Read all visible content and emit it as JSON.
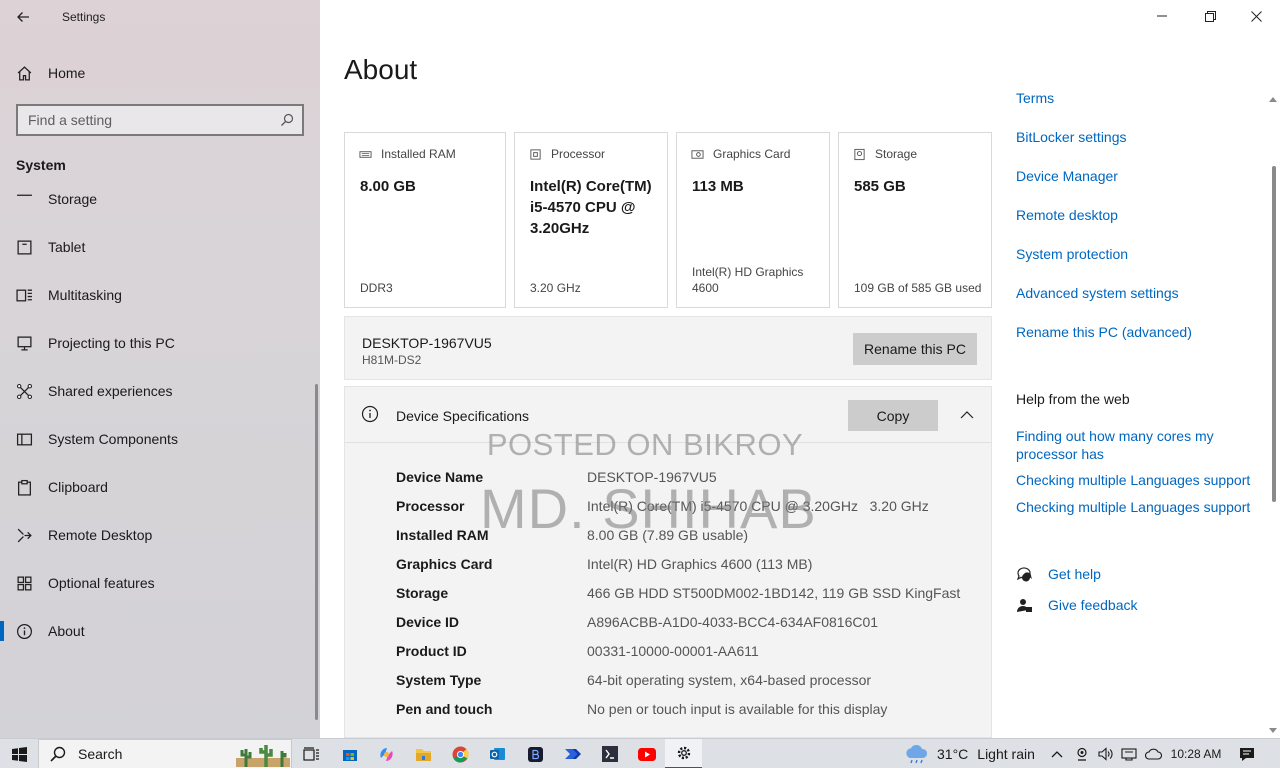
{
  "window": {
    "app_title": "Settings"
  },
  "sidebar": {
    "home_label": "Home",
    "search_placeholder": "Find a setting",
    "section_title": "System",
    "items": [
      {
        "label": "Storage",
        "icon": "storage-icon"
      },
      {
        "label": "Tablet",
        "icon": "tablet-icon"
      },
      {
        "label": "Multitasking",
        "icon": "multitasking-icon"
      },
      {
        "label": "Projecting to this PC",
        "icon": "projecting-icon"
      },
      {
        "label": "Shared experiences",
        "icon": "shared-experiences-icon"
      },
      {
        "label": "System Components",
        "icon": "system-components-icon"
      },
      {
        "label": "Clipboard",
        "icon": "clipboard-icon"
      },
      {
        "label": "Remote Desktop",
        "icon": "remote-desktop-icon"
      },
      {
        "label": "Optional features",
        "icon": "optional-features-icon"
      },
      {
        "label": "About",
        "icon": "about-icon",
        "active": true
      }
    ]
  },
  "main": {
    "page_title": "About",
    "cards": [
      {
        "title": "Installed RAM",
        "value": "8.00 GB",
        "foot": "DDR3",
        "icon": "ram-icon"
      },
      {
        "title": "Processor",
        "value": "Intel(R) Core(TM) i5-4570 CPU @ 3.20GHz",
        "foot": "3.20 GHz",
        "icon": "processor-icon"
      },
      {
        "title": "Graphics Card",
        "value": "113 MB",
        "foot": "Intel(R) HD Graphics 4600",
        "icon": "graphics-card-icon"
      },
      {
        "title": "Storage",
        "value": "585 GB",
        "foot": "109 GB of 585 GB used",
        "icon": "storage-drive-icon"
      }
    ],
    "pc": {
      "name": "DESKTOP-1967VU5",
      "model": "H81M-DS2",
      "rename_label": "Rename this PC"
    },
    "spec": {
      "title": "Device Specifications",
      "copy_label": "Copy",
      "rows": [
        {
          "label": "Device Name",
          "value": "DESKTOP-1967VU5"
        },
        {
          "label": "Processor",
          "value": "Intel(R) Core(TM) i5-4570 CPU @ 3.20GHz   3.20 GHz"
        },
        {
          "label": "Installed RAM",
          "value": "8.00 GB (7.89 GB usable)"
        },
        {
          "label": "Graphics Card",
          "value": "Intel(R) HD Graphics 4600 (113 MB)"
        },
        {
          "label": "Storage",
          "value": "466 GB HDD ST500DM002-1BD142, 119 GB SSD KingFast"
        },
        {
          "label": "Device ID",
          "value": "A896ACBB-A1D0-4033-BCC4-634AF0816C01"
        },
        {
          "label": "Product ID",
          "value": "00331-10000-00001-AA611"
        },
        {
          "label": "System Type",
          "value": "64-bit operating system, x64-based processor"
        },
        {
          "label": "Pen and touch",
          "value": "No pen or touch input is available for this display"
        }
      ]
    },
    "watermark": {
      "line1": "POSTED ON BIKROY",
      "line2": "MD. SHIHAB"
    }
  },
  "related": {
    "links": [
      "Terms",
      "BitLocker settings",
      "Device Manager",
      "Remote desktop",
      "System protection",
      "Advanced system settings",
      "Rename this PC (advanced)"
    ],
    "help_title": "Help from the web",
    "help_links": [
      "Finding out how many cores my processor has",
      "Checking multiple Languages support",
      "Checking multiple Languages support"
    ],
    "get_help": "Get help",
    "give_feedback": "Give feedback"
  },
  "taskbar": {
    "search_label": "Search",
    "weather_temp": "31°C",
    "weather_desc": "Light rain",
    "time": "10:28 AM",
    "apps": [
      "task-view-icon",
      "store-icon",
      "copilot-icon",
      "file-explorer-icon",
      "chrome-icon",
      "outlook-icon",
      "bootstrap-app-icon",
      "power-automate-icon",
      "visual-studio-icon",
      "youtube-icon",
      "settings-icon"
    ]
  },
  "colors": {
    "accent": "#0067c0",
    "button_gray": "#cccccc",
    "panel_gray": "#f3f3f3"
  }
}
